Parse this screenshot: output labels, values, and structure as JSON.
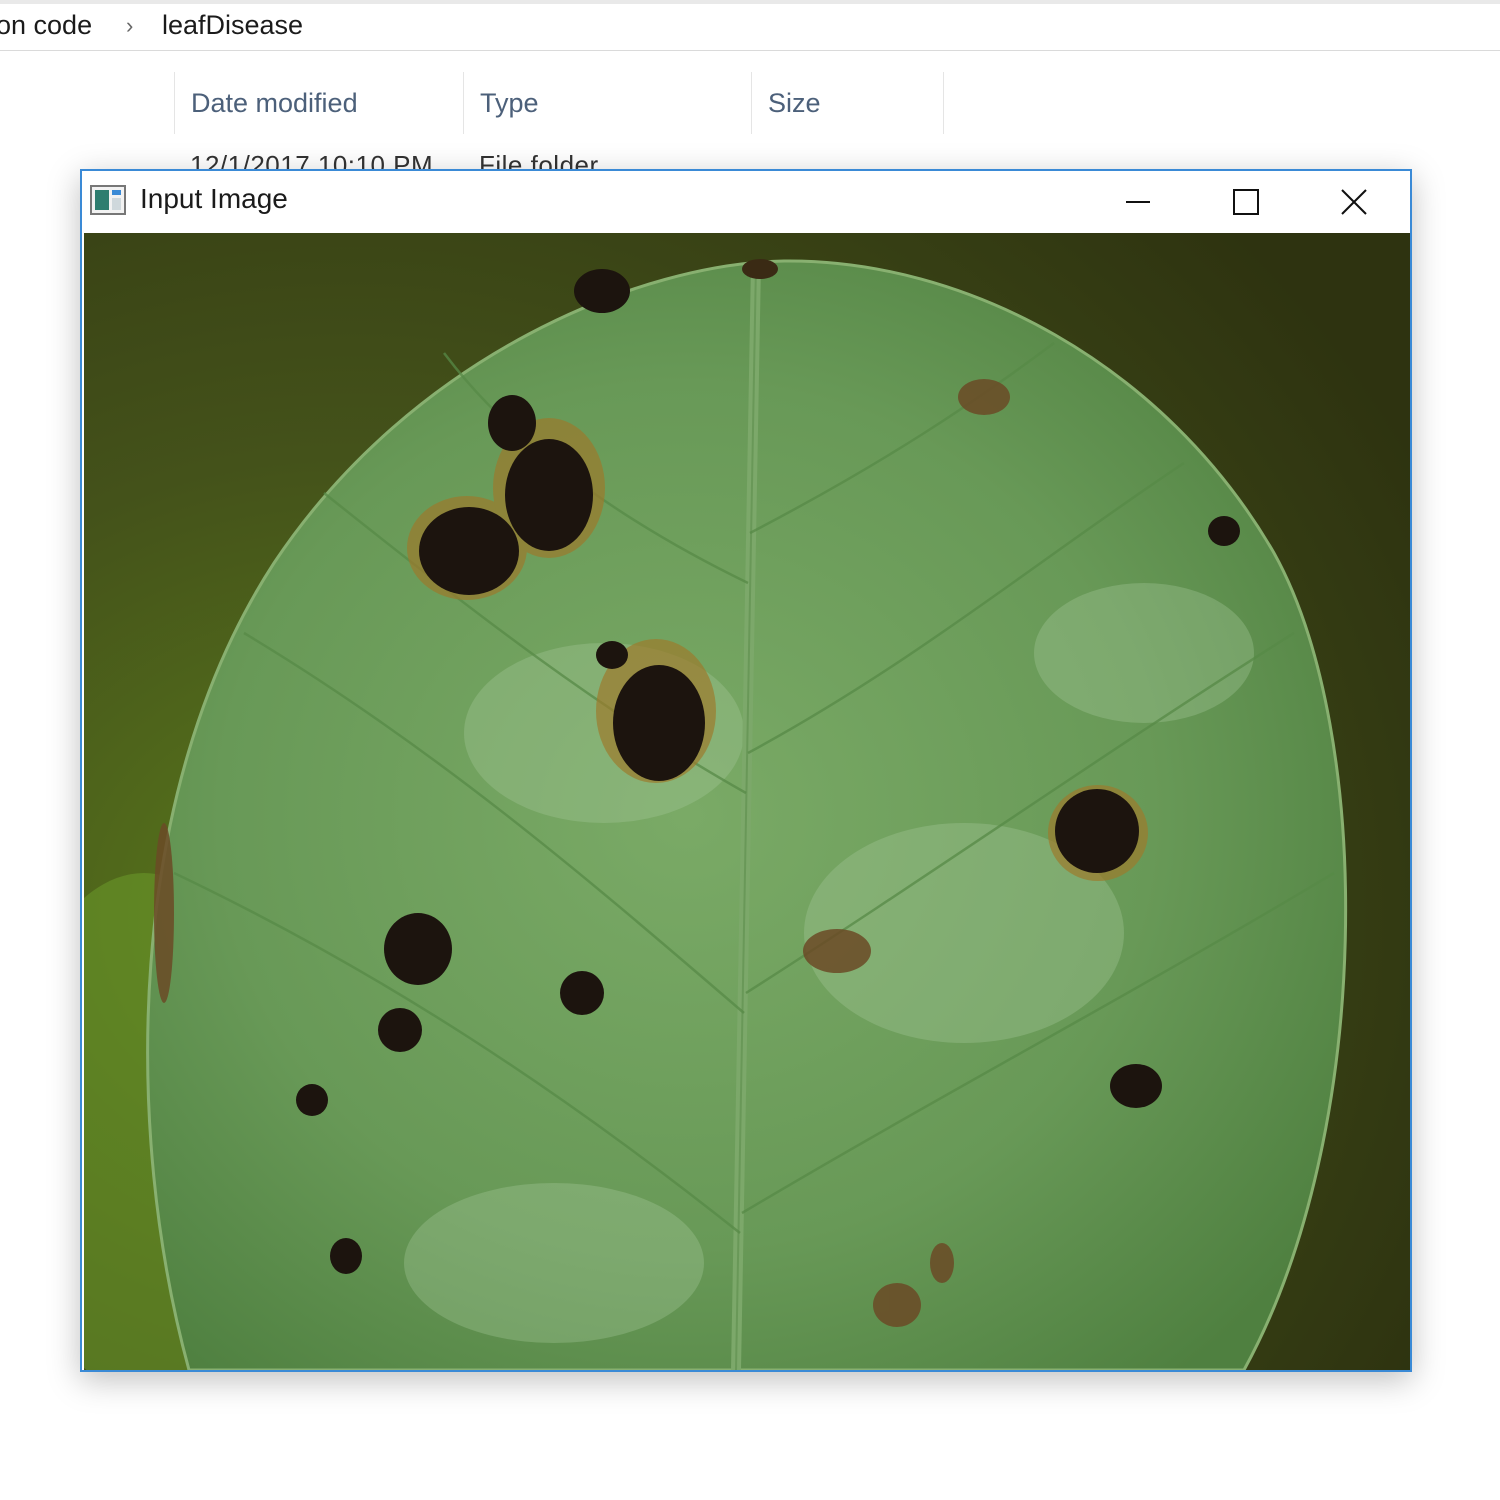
{
  "explorer": {
    "breadcrumb_prev": "on code",
    "breadcrumb_separator": "›",
    "breadcrumb_current": "leafDisease",
    "columns": {
      "date_modified": "Date modified",
      "type": "Type",
      "size": "Size"
    },
    "row_peek": {
      "date": "12/1/2017 10:10 PM",
      "type": "File folder"
    }
  },
  "window": {
    "title": "Input Image",
    "accent_color": "#3a8ad6",
    "icons": [
      "app-icon",
      "minimize-icon",
      "maximize-icon",
      "close-icon"
    ]
  },
  "image": {
    "subject": "green leaf with dark disease spots",
    "leaf_color": "#6a9a58",
    "background_color": "#3c4716",
    "spot_color": "#1c140e"
  }
}
